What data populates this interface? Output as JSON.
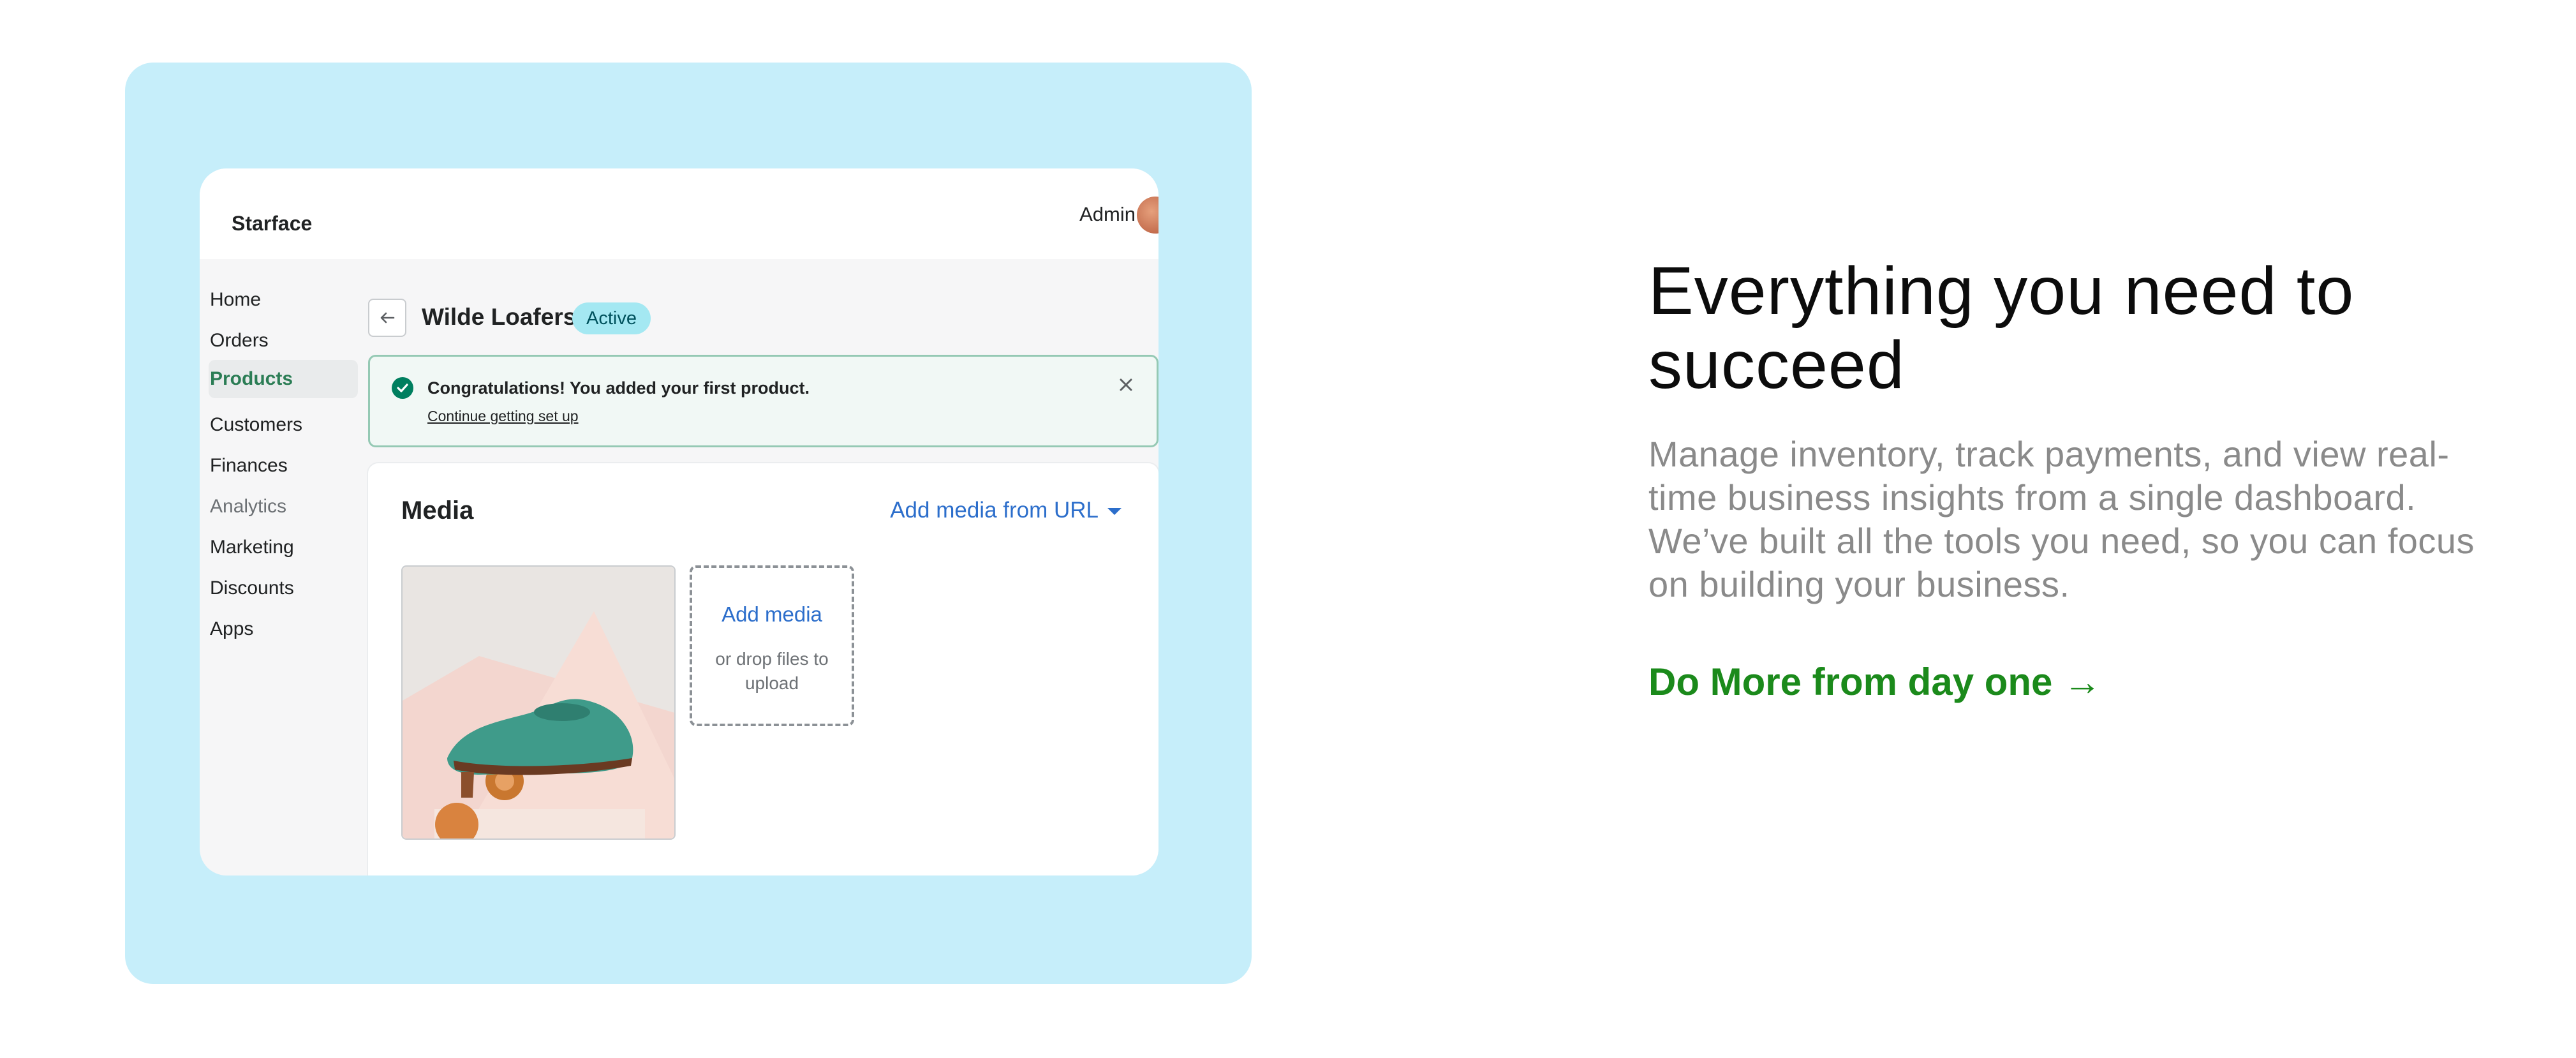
{
  "app": {
    "store_name": "Starface",
    "admin_label": "Admin",
    "nav": [
      {
        "label": "Home",
        "state": "normal"
      },
      {
        "label": "Orders",
        "state": "normal"
      },
      {
        "label": "Products",
        "state": "active"
      },
      {
        "label": "Customers",
        "state": "normal"
      },
      {
        "label": "Finances",
        "state": "normal"
      },
      {
        "label": "Analytics",
        "state": "muted"
      },
      {
        "label": "Marketing",
        "state": "normal"
      },
      {
        "label": "Discounts",
        "state": "normal"
      },
      {
        "label": "Apps",
        "state": "normal"
      }
    ],
    "product": {
      "back_icon": "arrow-left-icon",
      "title": "Wilde Loafers",
      "status": "Active"
    },
    "banner": {
      "icon": "check-circle-icon",
      "message": "Congratulations! You added your first product.",
      "link": "Continue getting set up",
      "close_icon": "close-icon"
    },
    "media": {
      "title": "Media",
      "add_url_label": "Add media from URL",
      "add_media_label": "Add media",
      "drop_hint": "or drop files to upload"
    }
  },
  "copy": {
    "headline": "Everything you need to succeed",
    "body": "Manage inventory, track payments, and view real-time business insights from a single dashboard. We’ve built all the tools you need, so you can focus on building your business.",
    "cta": "Do More from day one →"
  },
  "colors": {
    "hero_background": "#c6eefa",
    "cta_green": "#1b8a1b",
    "link_blue": "#2c6ecb",
    "success_green": "#007f5f",
    "badge_background": "#a4e8f2"
  }
}
